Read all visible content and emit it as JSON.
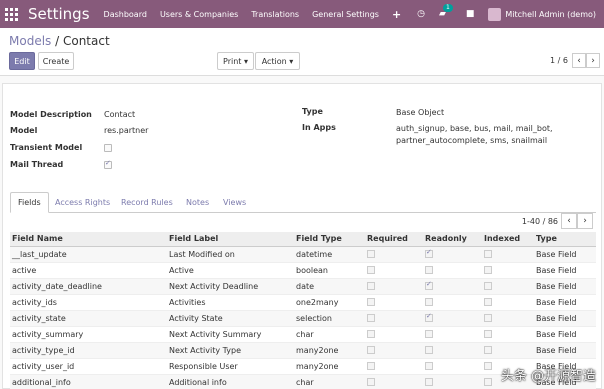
{
  "navbar": {
    "brand": "Settings",
    "menu": [
      "Dashboard",
      "Users & Companies",
      "Translations",
      "General Settings"
    ],
    "plus": "+",
    "chat_badge": "1",
    "user": "Mitchell Admin (demo)"
  },
  "breadcrumb": {
    "parent": "Models",
    "separator": "/",
    "current": "Contact"
  },
  "buttons": {
    "edit": "Edit",
    "create": "Create",
    "print": "Print ▾",
    "action": "Action ▾"
  },
  "pager": {
    "text": "1 / 6",
    "prev": "‹",
    "next": "›"
  },
  "form": {
    "model_description_label": "Model Description",
    "model_description": "Contact",
    "model_label": "Model",
    "model": "res.partner",
    "transient_label": "Transient Model",
    "transient": false,
    "mail_thread_label": "Mail Thread",
    "mail_thread": true,
    "type_label": "Type",
    "type": "Base Object",
    "in_apps_label": "In Apps",
    "in_apps_line1": "auth_signup, base, bus, mail, mail_bot,",
    "in_apps_line2": "partner_autocomplete, sms, snailmail"
  },
  "tabs": [
    "Fields",
    "Access Rights",
    "Record Rules",
    "Notes",
    "Views"
  ],
  "list": {
    "pager": "1-40 / 86",
    "columns": [
      "Field Name",
      "Field Label",
      "Field Type",
      "Required",
      "Readonly",
      "Indexed",
      "Type"
    ],
    "rows": [
      {
        "name": "__last_update",
        "label": "Last Modified on",
        "ftype": "datetime",
        "required": false,
        "readonly": true,
        "indexed": false,
        "type": "Base Field"
      },
      {
        "name": "active",
        "label": "Active",
        "ftype": "boolean",
        "required": false,
        "readonly": false,
        "indexed": false,
        "type": "Base Field"
      },
      {
        "name": "activity_date_deadline",
        "label": "Next Activity Deadline",
        "ftype": "date",
        "required": false,
        "readonly": true,
        "indexed": false,
        "type": "Base Field"
      },
      {
        "name": "activity_ids",
        "label": "Activities",
        "ftype": "one2many",
        "required": false,
        "readonly": false,
        "indexed": false,
        "type": "Base Field"
      },
      {
        "name": "activity_state",
        "label": "Activity State",
        "ftype": "selection",
        "required": false,
        "readonly": true,
        "indexed": false,
        "type": "Base Field"
      },
      {
        "name": "activity_summary",
        "label": "Next Activity Summary",
        "ftype": "char",
        "required": false,
        "readonly": false,
        "indexed": false,
        "type": "Base Field"
      },
      {
        "name": "activity_type_id",
        "label": "Next Activity Type",
        "ftype": "many2one",
        "required": false,
        "readonly": false,
        "indexed": false,
        "type": "Base Field"
      },
      {
        "name": "activity_user_id",
        "label": "Responsible User",
        "ftype": "many2one",
        "required": false,
        "readonly": false,
        "indexed": false,
        "type": "Base Field"
      },
      {
        "name": "additional_info",
        "label": "Additional info",
        "ftype": "char",
        "required": false,
        "readonly": false,
        "indexed": false,
        "type": "Base Field"
      }
    ]
  },
  "watermark": "头条 @开源智造",
  "colors": {
    "navbar": "#875a7b",
    "primary": "#7c7bad"
  }
}
